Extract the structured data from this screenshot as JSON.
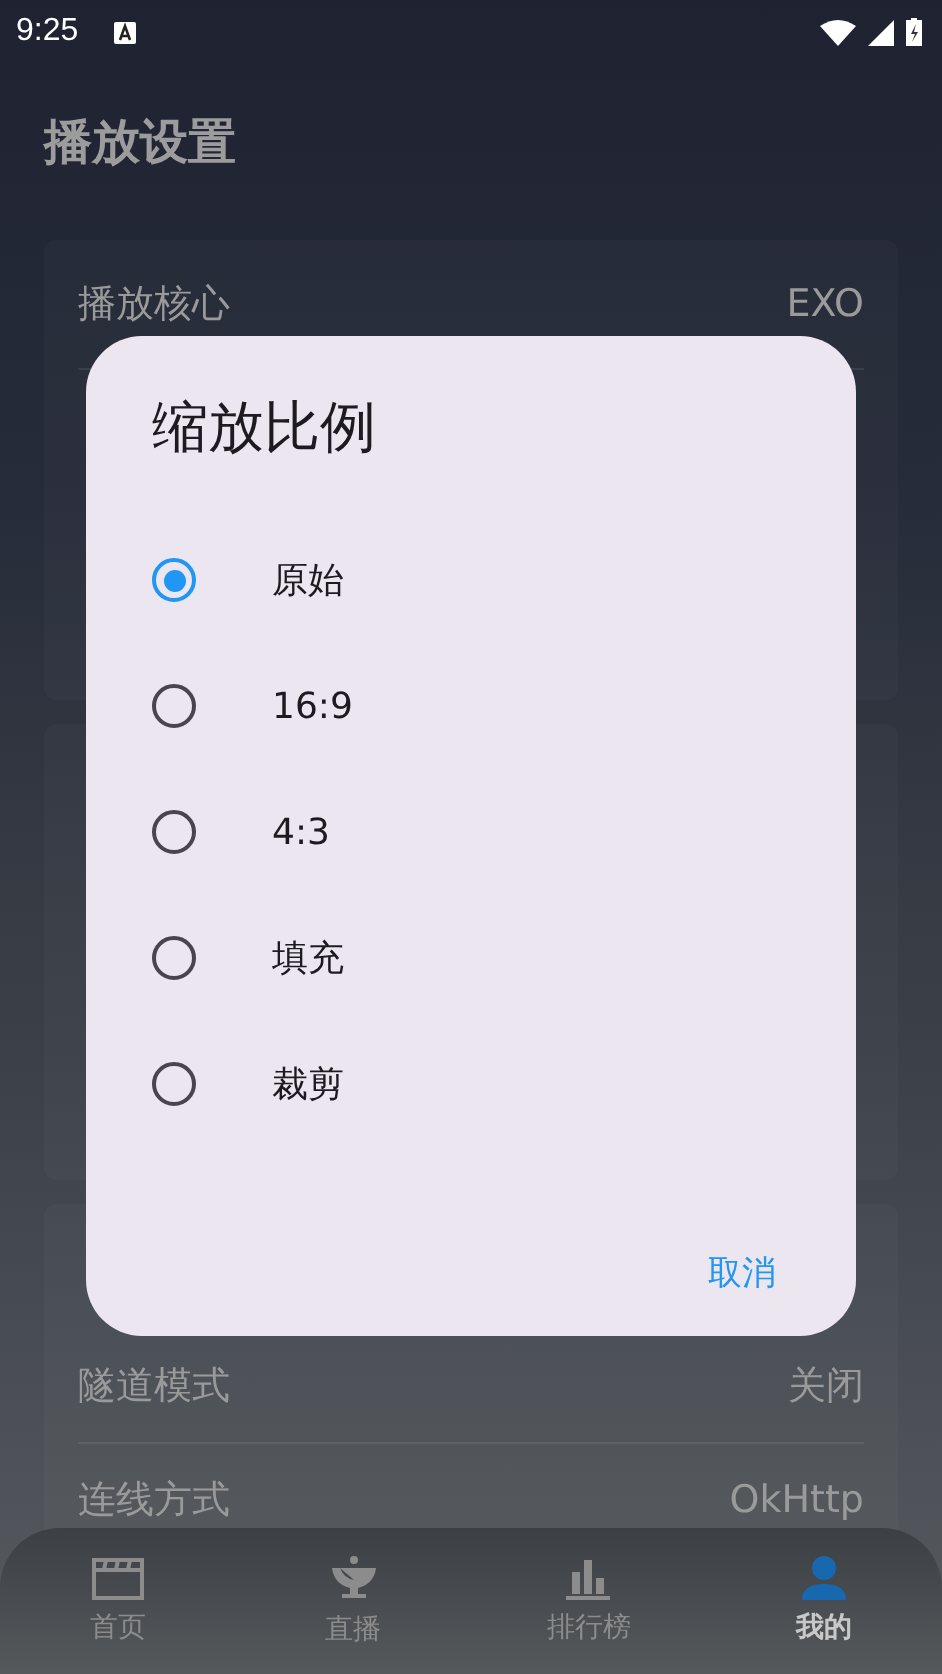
{
  "status_bar": {
    "time": "9:25"
  },
  "title": "播放设置",
  "cards": [
    {
      "kind": "top",
      "rows": [
        {
          "label": "播放核心",
          "value": "EXO"
        }
      ]
    },
    {
      "kind": "hidden"
    },
    {
      "kind": "bottom",
      "rows": [
        {
          "label": "隧道模式",
          "value": "关闭"
        },
        {
          "label": "连线方式",
          "value": "OkHttp"
        }
      ]
    }
  ],
  "dialog": {
    "title": "缩放比例",
    "options": [
      {
        "label": "原始",
        "selected": true
      },
      {
        "label": "16:9",
        "selected": false
      },
      {
        "label": "4:3",
        "selected": false
      },
      {
        "label": "填充",
        "selected": false
      },
      {
        "label": "裁剪",
        "selected": false
      }
    ],
    "cancel": "取消"
  },
  "nav": [
    {
      "kind": "clapper",
      "label": "首页",
      "selected": false
    },
    {
      "kind": "live",
      "label": "直播",
      "selected": false
    },
    {
      "kind": "chart",
      "label": "排行榜",
      "selected": false
    },
    {
      "kind": "person",
      "label": "我的",
      "selected": true
    }
  ]
}
